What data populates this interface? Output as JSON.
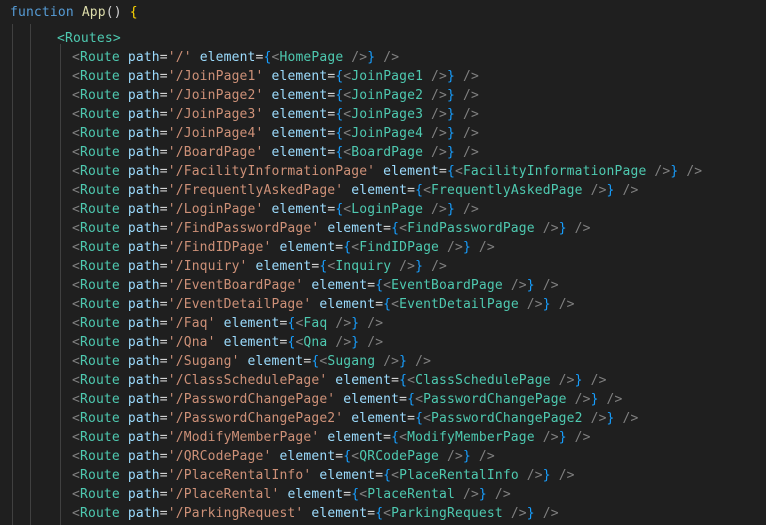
{
  "code": {
    "header": {
      "keyword": "function",
      "name": "App",
      "parens": "()",
      "brace": "{"
    },
    "routes_open": "<Routes>",
    "route_tag": "Route",
    "path_attr": "path",
    "element_attr": "element",
    "routes": [
      {
        "path": "'/'",
        "component": "HomePage"
      },
      {
        "path": "'/JoinPage1'",
        "component": "JoinPage1"
      },
      {
        "path": "'/JoinPage2'",
        "component": "JoinPage2"
      },
      {
        "path": "'/JoinPage3'",
        "component": "JoinPage3"
      },
      {
        "path": "'/JoinPage4'",
        "component": "JoinPage4"
      },
      {
        "path": "'/BoardPage'",
        "component": "BoardPage"
      },
      {
        "path": "'/FacilityInformationPage'",
        "component": "FacilityInformationPage"
      },
      {
        "path": "'/FrequentlyAskedPage'",
        "component": "FrequentlyAskedPage"
      },
      {
        "path": "'/LoginPage'",
        "component": "LoginPage"
      },
      {
        "path": "'/FindPasswordPage'",
        "component": "FindPasswordPage"
      },
      {
        "path": "'/FindIDPage'",
        "component": "FindIDPage"
      },
      {
        "path": "'/Inquiry'",
        "component": "Inquiry"
      },
      {
        "path": "'/EventBoardPage'",
        "component": "EventBoardPage"
      },
      {
        "path": "'/EventDetailPage'",
        "component": "EventDetailPage"
      },
      {
        "path": "'/Faq'",
        "component": "Faq"
      },
      {
        "path": "'/Qna'",
        "component": "Qna"
      },
      {
        "path": "'/Sugang'",
        "component": "Sugang"
      },
      {
        "path": "'/ClassSchedulePage'",
        "component": "ClassSchedulePage"
      },
      {
        "path": "'/PasswordChangePage'",
        "component": "PasswordChangePage"
      },
      {
        "path": "'/PasswordChangePage2'",
        "component": "PasswordChangePage2"
      },
      {
        "path": "'/ModifyMemberPage'",
        "component": "ModifyMemberPage"
      },
      {
        "path": "'/QRCodePage'",
        "component": "QRCodePage"
      },
      {
        "path": "'/PlaceRentalInfo'",
        "component": "PlaceRentalInfo"
      },
      {
        "path": "'/PlaceRental'",
        "component": "PlaceRental"
      },
      {
        "path": "'/ParkingRequest'",
        "component": "ParkingRequest"
      }
    ]
  },
  "colors": {
    "background": "#1f1f1f",
    "keyword": "#569cd6",
    "function_name": "#dcdcaa",
    "tag": "#4ec9b0",
    "attribute": "#9cdcfe",
    "string": "#ce9178",
    "bracket_gold": "#ffd700",
    "bracket_blue": "#179fff"
  }
}
